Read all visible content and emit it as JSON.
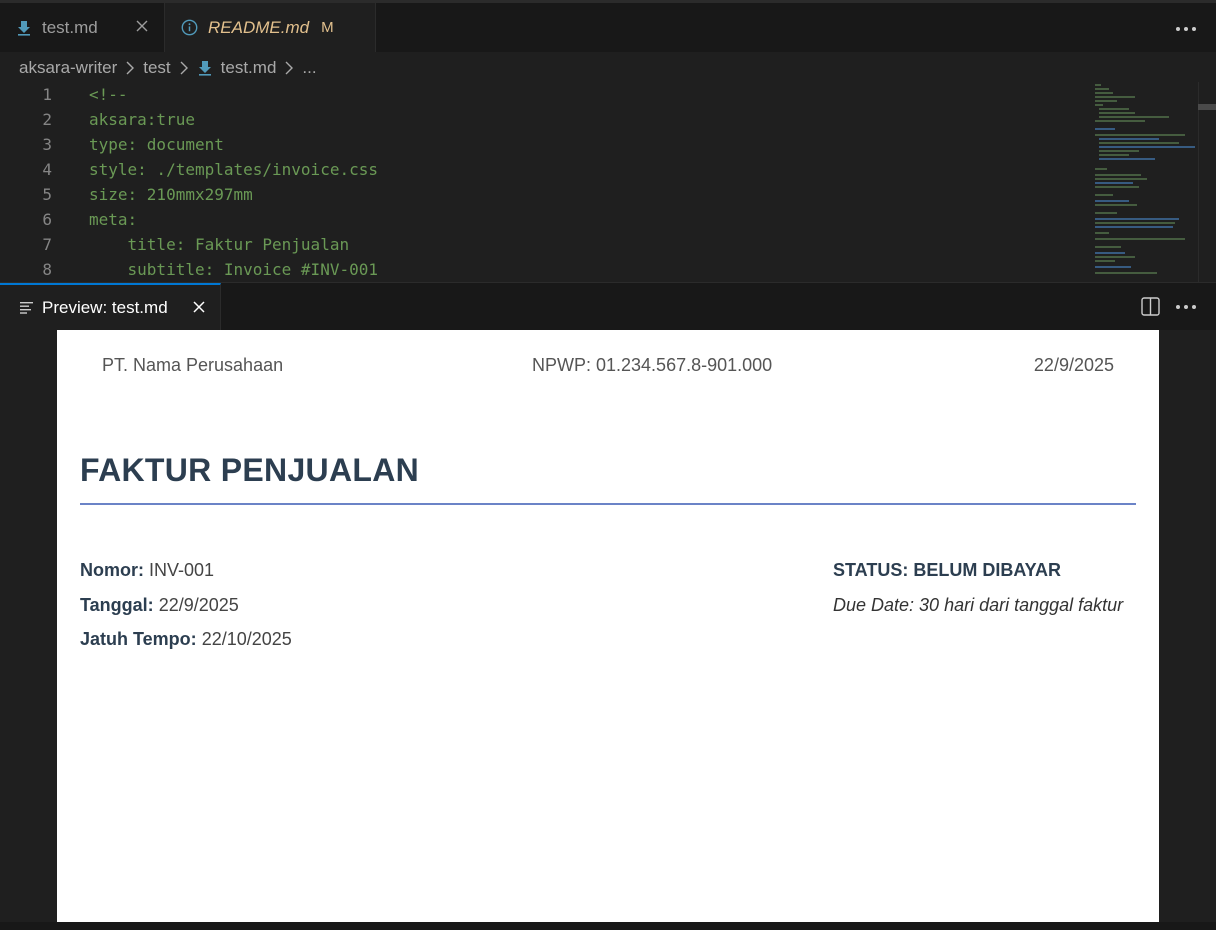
{
  "tabs": [
    {
      "label": "test.md",
      "icon": "markdown-arrow-icon",
      "active": false
    },
    {
      "label": "README.md",
      "badge": "M",
      "icon": "info-icon",
      "active": true
    }
  ],
  "breadcrumb": [
    "aksara-writer",
    "test",
    "test.md",
    "..."
  ],
  "editor": {
    "lines": [
      {
        "n": "1",
        "text": "<!--"
      },
      {
        "n": "2",
        "text": "aksara:true"
      },
      {
        "n": "3",
        "text": "type: document"
      },
      {
        "n": "4",
        "text": "style: ./templates/invoice.css"
      },
      {
        "n": "5",
        "text": "size: 210mmx297mm"
      },
      {
        "n": "6",
        "text": "meta:"
      },
      {
        "n": "7",
        "text": "    title: Faktur Penjualan"
      },
      {
        "n": "8",
        "text": "    subtitle: Invoice #INV-001"
      }
    ]
  },
  "preview_tab": {
    "label": "Preview: test.md"
  },
  "document": {
    "header": {
      "company": "PT. Nama Perusahaan",
      "npwp": "NPWP: 01.234.567.8-901.000",
      "date": "22/9/2025"
    },
    "title": "FAKTUR PENJUALAN",
    "meta": [
      {
        "label": "Nomor:",
        "value": "INV-001"
      },
      {
        "label": "Tanggal:",
        "value": "22/9/2025"
      },
      {
        "label": "Jatuh Tempo:",
        "value": "22/10/2025"
      }
    ],
    "status": "STATUS: BELUM DIBAYAR",
    "due": "Due Date: 30 hari dari tanggal faktur"
  },
  "colors": {
    "accent": "#0078d4",
    "comment_green": "#6a9955",
    "modified": "#e2c08d",
    "title": "#2c3e50",
    "rule": "#6b83c7"
  }
}
